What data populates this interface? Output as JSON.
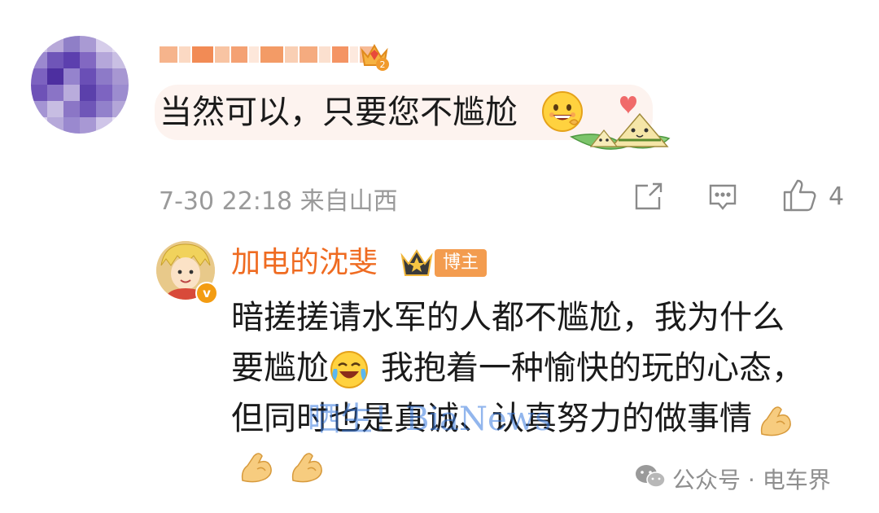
{
  "top_comment": {
    "text": "当然可以，只要您不尴尬",
    "meta": "7-30 22:18 来自山西",
    "like_count": "4",
    "level_badge": "2"
  },
  "reply": {
    "username": "加电的沈斐",
    "author_tag": "博主",
    "line1": "暗搓搓请水军的人都不尴尬，我为什么",
    "line2_a": "要尴尬",
    "line2_b": "我抱着一种愉快的玩的心态，",
    "line3": "但同时也是真诚、认真努力的做事情",
    "watermark": "晒生！BiaNews"
  },
  "footer": {
    "text": "公众号 · 电车界"
  },
  "colors": {
    "accent_orange": "#ef6b21",
    "meta_gray": "#9a9a9a",
    "bubble": "#fdf3ef"
  }
}
